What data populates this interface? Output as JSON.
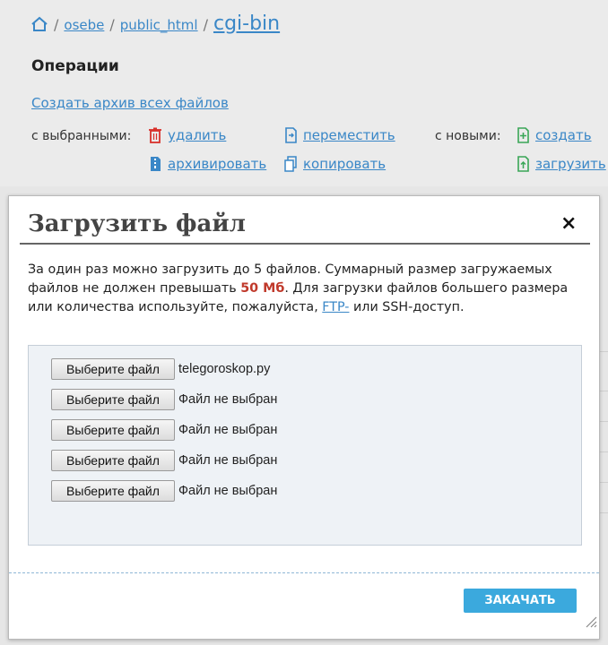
{
  "breadcrumb": {
    "items": [
      "osebe",
      "public_html"
    ],
    "current": "cgi-bin",
    "separator": "/"
  },
  "operations": {
    "title": "Операции",
    "archive_all": "Создать архив всех файлов",
    "with_selected_label": "с выбранными:",
    "with_new_label": "с новыми:",
    "delete": "удалить",
    "move": "переместить",
    "archive": "архивировать",
    "copy": "копировать",
    "create": "создать",
    "upload": "загрузить"
  },
  "modal": {
    "title": "Загрузить файл",
    "close": "×",
    "desc_part1": "За один раз можно загрузить до 5 файлов. Суммарный размер загружаемых файлов не должен превышать ",
    "desc_limit": "50 Мб",
    "desc_part2": ". Для загрузки файлов большего размера или количества используйте, пожалуйста, ",
    "desc_ftp": "FTP-",
    "desc_part3": " или SSH-доступ.",
    "choose_label": "Выберите файл",
    "files": [
      "telegoroskop.py",
      "Файл не выбран",
      "Файл не выбран",
      "Файл не выбран",
      "Файл не выбран"
    ],
    "submit": "ЗАКАЧАТЬ"
  },
  "colors": {
    "link": "#3a87c7",
    "limit": "#c0392b",
    "submit": "#3ba9dd",
    "delete_icon": "#d9322c",
    "new_icon": "#3aa657"
  }
}
